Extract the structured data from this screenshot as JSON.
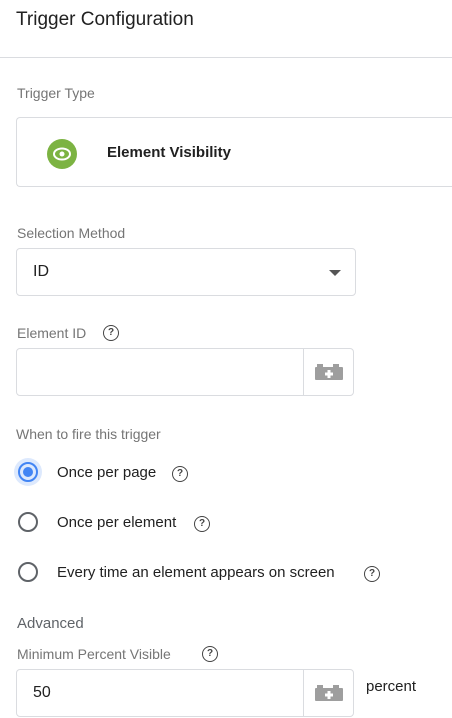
{
  "header": {
    "title": "Trigger Configuration"
  },
  "trigger_type": {
    "label": "Trigger Type",
    "name": "Element Visibility",
    "icon": "eye-icon",
    "icon_color": "#7cb342"
  },
  "selection_method": {
    "label": "Selection Method",
    "value": "ID"
  },
  "element_id": {
    "label": "Element ID",
    "value": "",
    "help": "?"
  },
  "fire": {
    "label": "When to fire this trigger",
    "options": [
      {
        "label": "Once per page",
        "checked": true,
        "help": "?"
      },
      {
        "label": "Once per element",
        "checked": false,
        "help": "?"
      },
      {
        "label": "Every time an element appears on screen",
        "checked": false,
        "help": "?"
      }
    ]
  },
  "advanced": {
    "heading": "Advanced",
    "min_percent_label": "Minimum Percent Visible",
    "min_percent_value": "50",
    "unit": "percent",
    "help": "?"
  },
  "colors": {
    "accent": "#4285f4",
    "border": "#dadce0"
  }
}
